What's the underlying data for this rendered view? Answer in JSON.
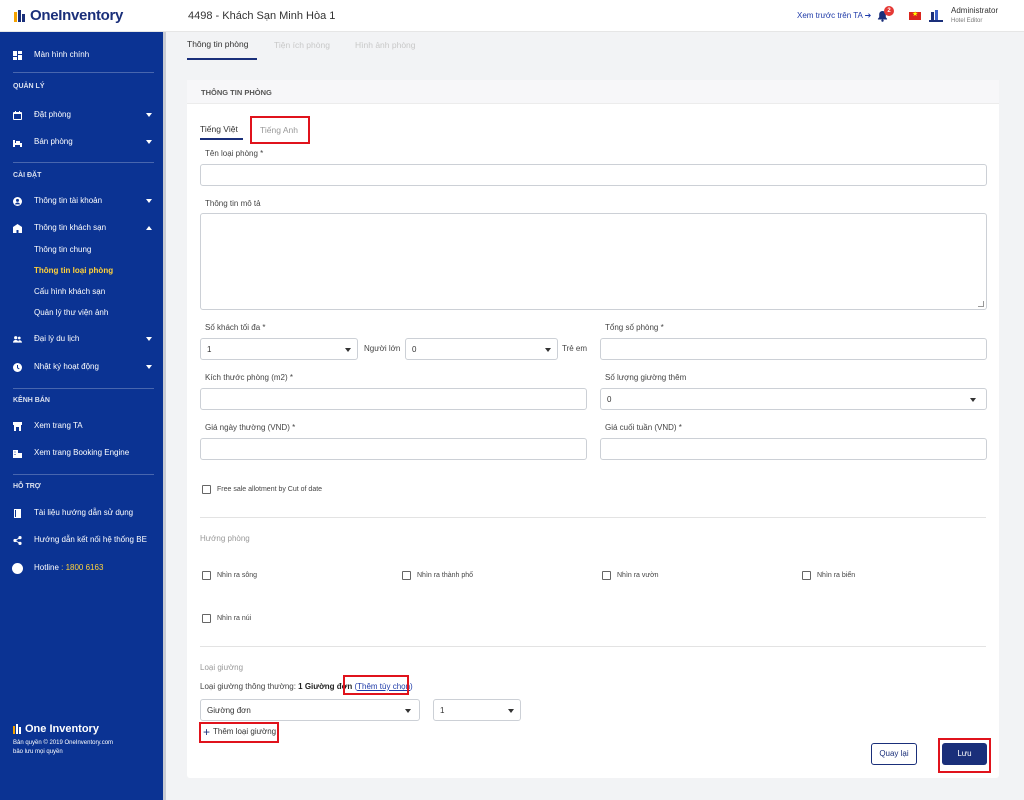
{
  "app": {
    "logo_text": "OneInventory",
    "hotel_name": "4498 - Khách Sạn Minh Hòa 1",
    "preview_link": "Xem trước trên TA ➔",
    "notification_count": "2",
    "user_name": "Administrator",
    "user_role": "Hotel Editor"
  },
  "sidebar": {
    "home": "Màn hình chính",
    "section_manage": "QUẢN LÝ",
    "booking": "Đặt phòng",
    "sell_room": "Bán phòng",
    "section_settings": "CÀI ĐẶT",
    "account_info": "Thông tin tài khoản",
    "hotel_info": "Thông tin khách sạn",
    "sub_items": [
      "Thông tin chung",
      "Thông tin loại phòng",
      "Cấu hình khách sạn",
      "Quản lý thư viện ảnh"
    ],
    "travel_agent": "Đại lý du lịch",
    "activity_log": "Nhật ký hoạt động",
    "section_channel": "KÊNH BÁN",
    "view_ta": "Xem trang TA",
    "view_be": "Xem trang Booking Engine",
    "section_support": "HỖ TRỢ",
    "docs": "Tài liệu hướng dẫn sử dụng",
    "be_connect": "Hướng dẫn kết nối hệ thống BE",
    "hotline_label": "Hotline",
    "hotline_value": ": 1800 6163",
    "footer_logo": "One Inventory",
    "copyright_1": "Bản quyền © 2019 OneInventory.com",
    "copyright_2": "bảo lưu mọi quyền"
  },
  "page_tabs": [
    "Thông tin phòng",
    "Tiện ích phòng",
    "Hình ảnh phòng"
  ],
  "card": {
    "title": "THÔNG TIN PHÒNG",
    "lang_tabs": [
      "Tiếng Việt",
      "Tiếng Anh"
    ],
    "room_type_label": "Tên loại phòng *",
    "description_label": "Thông tin mô tả",
    "max_guests_label": "Số khách tối đa *",
    "adults_value": "1",
    "adults_unit": "Người lớn",
    "children_value": "0",
    "children_unit": "Trẻ em",
    "total_rooms_label": "Tổng số phòng *",
    "room_size_label": "Kích thước phòng (m2) *",
    "extra_beds_label": "Số lượng giường thêm",
    "extra_beds_value": "0",
    "weekday_price_label": "Giá ngày thường (VND) *",
    "weekend_price_label": "Giá cuối tuần (VND) *",
    "free_sale_label": "Free sale allotment by Cut of date",
    "direction_label": "Hướng phòng",
    "directions": [
      "Nhìn ra sông",
      "Nhìn ra thành phố",
      "Nhìn ra vườn",
      "Nhìn ra biển",
      "Nhìn ra núi"
    ],
    "bed_type_label": "Loại giường",
    "bed_normal_prefix": "Loại giường thông thường: ",
    "bed_normal_value": "1 Giường đơn",
    "bed_option_link": "Thêm tùy chọn",
    "bed_select_value": "Giường đơn",
    "bed_count_value": "1",
    "add_bed_label": "Thêm loại giường",
    "back_button": "Quay lại",
    "save_button": "Lưu"
  },
  "colors": {
    "sidebar_bg": "#0b3393",
    "primary": "#1a2f7a",
    "active_sub": "#ffd23a",
    "highlight_box": "#e0131c"
  }
}
